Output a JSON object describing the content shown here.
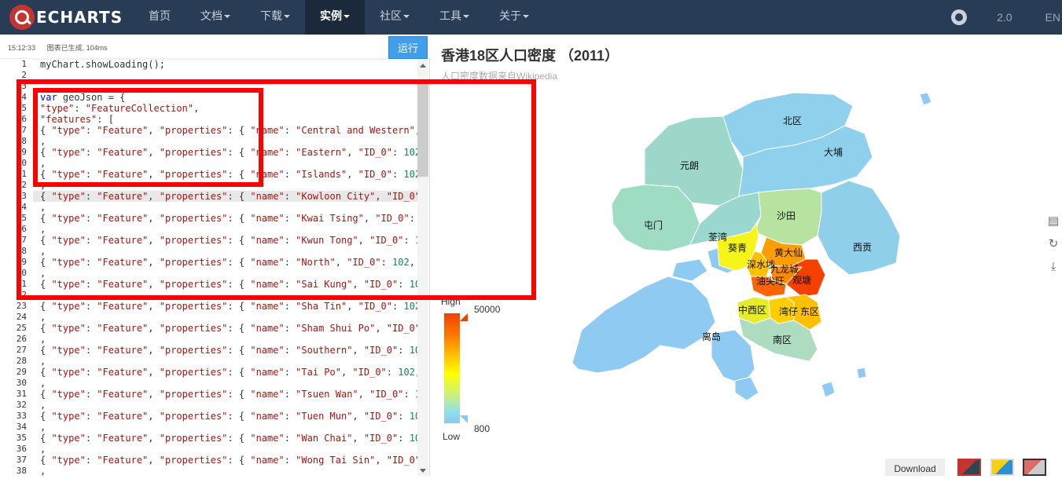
{
  "nav": {
    "logo_text": "ECHARTS",
    "items": [
      {
        "label": "首页",
        "caret": false,
        "active": false
      },
      {
        "label": "文档",
        "caret": true,
        "active": false
      },
      {
        "label": "下载",
        "caret": true,
        "active": false
      },
      {
        "label": "实例",
        "caret": true,
        "active": true
      },
      {
        "label": "社区",
        "caret": true,
        "active": false
      },
      {
        "label": "工具",
        "caret": true,
        "active": false
      },
      {
        "label": "关于",
        "caret": true,
        "active": false
      }
    ],
    "version": "2.0",
    "lang": "EN"
  },
  "editor": {
    "status_time": "15:12:33",
    "status_msg": "图表已生成, 104ms",
    "run_label": "运行",
    "line_numbers": [
      "1",
      "2",
      "3",
      "4",
      "5",
      "6",
      "7",
      "8",
      "9",
      "0",
      "1",
      "2",
      "3",
      "4",
      "5",
      "6",
      "7",
      "8",
      "9",
      "0",
      "1",
      "2",
      "23",
      "24",
      "25",
      "26",
      "27",
      "28",
      "29",
      "30",
      "31",
      "32",
      "33",
      "34",
      "35",
      "36",
      "37",
      "38"
    ],
    "lines": [
      "myChart.showLoading();",
      "",
      "",
      "var geoJson = {",
      "\"type\": \"FeatureCollection\",",
      "\"features\": [",
      "{ \"type\": \"Feature\", \"properties\": { \"name\": \"Central and Western\", \"",
      ",",
      "{ \"type\": \"Feature\", \"properties\": { \"name\": \"Eastern\", \"ID_0\": 102,",
      ",",
      "{ \"type\": \"Feature\", \"properties\": { \"name\": \"Islands\", \"ID_0\": 102,",
      ",",
      "{ \"type\": \"Feature\", \"properties\": { \"name\": \"Kowloon City\", \"ID_0\":",
      ",",
      "{ \"type\": \"Feature\", \"properties\": { \"name\": \"Kwai Tsing\", \"ID_0\": 10",
      ",",
      "{ \"type\": \"Feature\", \"properties\": { \"name\": \"Kwun Tong\", \"ID_0\": 10",
      ",",
      "{ \"type\": \"Feature\", \"properties\": { \"name\": \"North\", \"ID_0\": 102, \"",
      ",",
      "{ \"type\": \"Feature\", \"properties\": { \"name\": \"Sai Kung\", \"ID_0\": 102",
      ",",
      "{ \"type\": \"Feature\", \"properties\": { \"name\": \"Sha Tin\", \"ID_0\": 102,",
      ",",
      "{ \"type\": \"Feature\", \"properties\": { \"name\": \"Sham Shui Po\", \"ID_0\":",
      ",",
      "{ \"type\": \"Feature\", \"properties\": { \"name\": \"Southern\", \"ID_0\": 102",
      ",",
      "{ \"type\": \"Feature\", \"properties\": { \"name\": \"Tai Po\", \"ID_0\": 102, \"",
      ",",
      "{ \"type\": \"Feature\", \"properties\": { \"name\": \"Tsuen Wan\", \"ID_0\": 10",
      ",",
      "{ \"type\": \"Feature\", \"properties\": { \"name\": \"Tuen Mun\", \"ID_0\": 102",
      ",",
      "{ \"type\": \"Feature\", \"properties\": { \"name\": \"Wan Chai\", \"ID_0\": 102",
      ",",
      "{ \"type\": \"Feature\", \"properties\": { \"name\": \"Wong Tai Sin\", \"ID_0\":",
      ","
    ]
  },
  "chart": {
    "title": "香港18区人口密度 （2011）",
    "subtitle": "人口密度数据来自Wikipedia",
    "visualmap": {
      "high_label": "High",
      "low_label": "Low",
      "max": "50000",
      "min": "800"
    },
    "districts": [
      "北区",
      "大埔",
      "元朗",
      "屯门",
      "沙田",
      "荃湾",
      "葵青",
      "黄大仙",
      "深水埗",
      "九龙城",
      "油尖旺",
      "观塘",
      "西贡",
      "中西区",
      "湾仔",
      "东区",
      "南区",
      "离岛"
    ],
    "download_label": "Download"
  }
}
